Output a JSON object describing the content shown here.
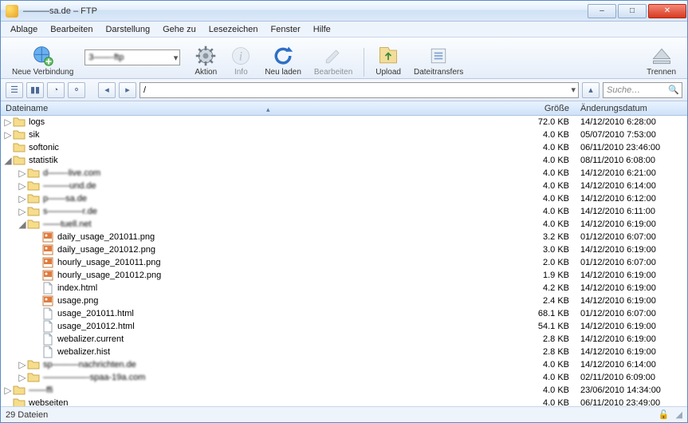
{
  "title": "———sa.de – FTP",
  "window_buttons": {
    "min": "–",
    "max": "□",
    "close": "✕"
  },
  "menus": [
    "Ablage",
    "Bearbeiten",
    "Darstellung",
    "Gehe zu",
    "Lesezeichen",
    "Fenster",
    "Hilfe"
  ],
  "toolbar": {
    "new_connection": "Neue Verbindung",
    "address_value": "3——-ftp",
    "aktion": "Aktion",
    "info": "Info",
    "neu_laden": "Neu laden",
    "bearbeiten": "Bearbeiten",
    "upload": "Upload",
    "dateitransfers": "Dateitransfers",
    "trennen": "Trennen"
  },
  "pathbar": {
    "path": "/",
    "search_placeholder": "Suche…"
  },
  "columns": {
    "name": "Dateiname",
    "size": "Größe",
    "date": "Änderungsdatum"
  },
  "rows": [
    {
      "indent": 0,
      "exp": "▷",
      "type": "folder",
      "name": "logs",
      "size": "72.0 KB",
      "date": "14/12/2010 6:28:00"
    },
    {
      "indent": 0,
      "exp": "▷",
      "type": "folder",
      "name": "sik",
      "size": "4.0 KB",
      "date": "05/07/2010 7:53:00"
    },
    {
      "indent": 0,
      "exp": "",
      "type": "folder",
      "name": "softonic",
      "size": "4.0 KB",
      "date": "06/11/2010 23:46:00"
    },
    {
      "indent": 0,
      "exp": "◢",
      "type": "folder",
      "name": "statistik",
      "size": "4.0 KB",
      "date": "08/11/2010 6:08:00"
    },
    {
      "indent": 1,
      "exp": "▷",
      "type": "folder",
      "name": "d——-live.com",
      "blur": true,
      "size": "4.0 KB",
      "date": "14/12/2010 6:21:00"
    },
    {
      "indent": 1,
      "exp": "▷",
      "type": "folder",
      "name": "———und.de",
      "blur": true,
      "size": "4.0 KB",
      "date": "14/12/2010 6:14:00"
    },
    {
      "indent": 1,
      "exp": "▷",
      "type": "folder",
      "name": "p——sa.de",
      "blur": true,
      "size": "4.0 KB",
      "date": "14/12/2010 6:12:00"
    },
    {
      "indent": 1,
      "exp": "▷",
      "type": "folder",
      "name": "s————r.de",
      "blur": true,
      "size": "4.0 KB",
      "date": "14/12/2010 6:11:00"
    },
    {
      "indent": 1,
      "exp": "◢",
      "type": "folder",
      "name": "——tuell.net",
      "blur": true,
      "size": "4.0 KB",
      "date": "14/12/2010 6:19:00"
    },
    {
      "indent": 2,
      "exp": "",
      "type": "png",
      "name": "daily_usage_201011.png",
      "size": "3.2 KB",
      "date": "01/12/2010 6:07:00"
    },
    {
      "indent": 2,
      "exp": "",
      "type": "png",
      "name": "daily_usage_201012.png",
      "size": "3.0 KB",
      "date": "14/12/2010 6:19:00"
    },
    {
      "indent": 2,
      "exp": "",
      "type": "png",
      "name": "hourly_usage_201011.png",
      "size": "2.0 KB",
      "date": "01/12/2010 6:07:00"
    },
    {
      "indent": 2,
      "exp": "",
      "type": "png",
      "name": "hourly_usage_201012.png",
      "size": "1.9 KB",
      "date": "14/12/2010 6:19:00"
    },
    {
      "indent": 2,
      "exp": "",
      "type": "file",
      "name": "index.html",
      "size": "4.2 KB",
      "date": "14/12/2010 6:19:00"
    },
    {
      "indent": 2,
      "exp": "",
      "type": "png",
      "name": "usage.png",
      "size": "2.4 KB",
      "date": "14/12/2010 6:19:00"
    },
    {
      "indent": 2,
      "exp": "",
      "type": "file",
      "name": "usage_201011.html",
      "size": "68.1 KB",
      "date": "01/12/2010 6:07:00"
    },
    {
      "indent": 2,
      "exp": "",
      "type": "file",
      "name": "usage_201012.html",
      "size": "54.1 KB",
      "date": "14/12/2010 6:19:00"
    },
    {
      "indent": 2,
      "exp": "",
      "type": "file",
      "name": "webalizer.current",
      "size": "2.8 KB",
      "date": "14/12/2010 6:19:00"
    },
    {
      "indent": 2,
      "exp": "",
      "type": "file",
      "name": "webalizer.hist",
      "size": "2.8 KB",
      "date": "14/12/2010 6:19:00"
    },
    {
      "indent": 1,
      "exp": "▷",
      "type": "folder",
      "name": "sp———nachrichten.de",
      "blur": true,
      "size": "4.0 KB",
      "date": "14/12/2010 6:14:00"
    },
    {
      "indent": 1,
      "exp": "▷",
      "type": "folder",
      "name": "—————-spaa-19a.com",
      "blur": true,
      "size": "4.0 KB",
      "date": "02/11/2010 6:09:00"
    },
    {
      "indent": 0,
      "exp": "▷",
      "type": "folder",
      "name": "——ffi",
      "blur": true,
      "size": "4.0 KB",
      "date": "23/06/2010 14:34:00"
    },
    {
      "indent": 0,
      "exp": "",
      "type": "folder",
      "name": "webseiten",
      "size": "4.0 KB",
      "date": "06/11/2010 23:49:00"
    }
  ],
  "status": {
    "count": "29 Dateien"
  }
}
